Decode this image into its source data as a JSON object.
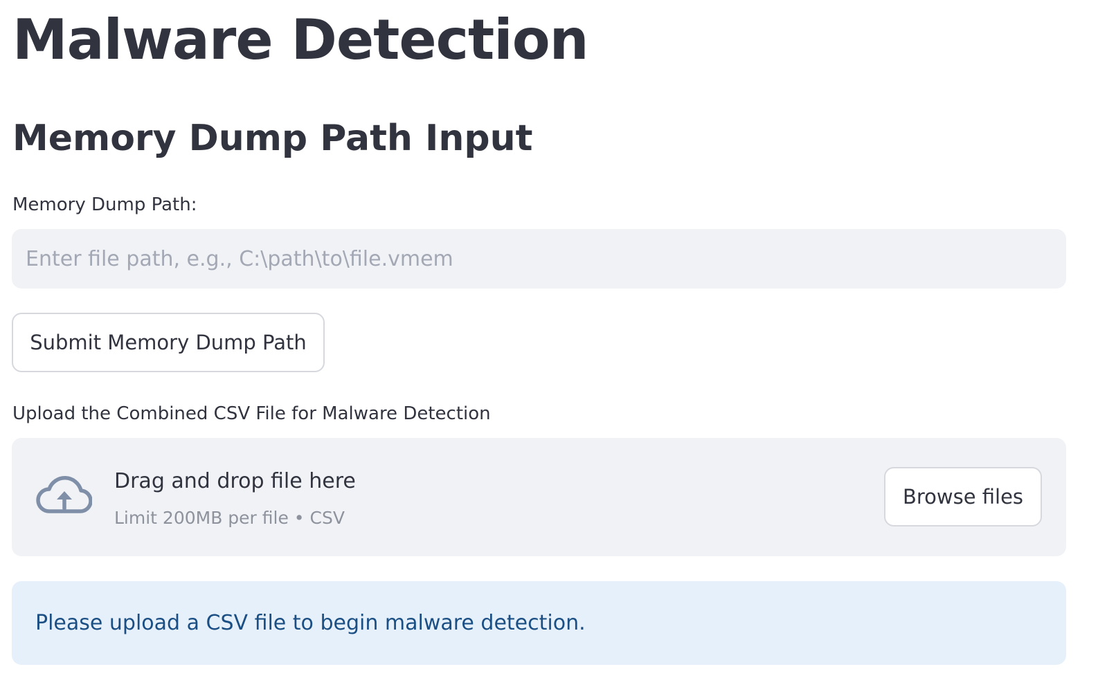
{
  "page": {
    "title": "Malware Detection"
  },
  "memory_dump": {
    "section_title": "Memory Dump Path Input",
    "field_label": "Memory Dump Path:",
    "input_value": "",
    "input_placeholder": "Enter file path, e.g., C:\\path\\to\\file.vmem",
    "submit_label": "Submit Memory Dump Path"
  },
  "csv_upload": {
    "label": "Upload the Combined CSV File for Malware Detection",
    "dropzone_title": "Drag and drop file here",
    "dropzone_limit": "Limit 200MB per file • CSV",
    "browse_label": "Browse files",
    "icon": "cloud-upload-icon"
  },
  "info_alert": {
    "message": "Please upload a CSV file to begin malware detection."
  },
  "colors": {
    "text": "#31333f",
    "input_background": "#f0f2f6",
    "muted_text": "#8e929c",
    "icon": "#7f8fa8",
    "info_background": "#e6f0fb",
    "info_text": "#1b4f84"
  }
}
